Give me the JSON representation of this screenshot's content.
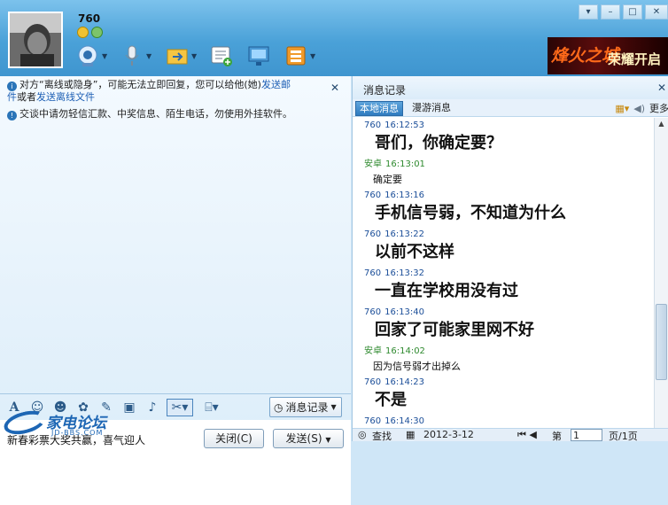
{
  "header": {
    "username": "760"
  },
  "toolbar": {
    "items": [
      "webcam",
      "microphone",
      "file-transfer",
      "sms",
      "remote-assistance",
      "apps"
    ]
  },
  "ad": {
    "text1": "烽火之城",
    "text2": "荣耀开启"
  },
  "left": {
    "notice1_a": "对方“离线或隐身”，可能无法立即回复，您可以给他(她)",
    "notice1_link1": "发送邮",
    "notice1_b": "件",
    "notice1_c": "或者",
    "notice1_link2": "发送离线文件",
    "notice2": "交谈中请勿轻信汇款、中奖信息、陌生电话，勿使用外挂软件。",
    "msg_record_btn": "消息记录",
    "bottom_text": "新春彩票大奖共赢，喜气迎人",
    "close_btn": "关闭(C)",
    "send_btn": "发送(S)",
    "logo_title": "家电论坛",
    "logo_sub": "JD-BBS.COM"
  },
  "right": {
    "title": "消息记录",
    "tab_local": "本地消息",
    "tab_roam": "漫游消息",
    "more": "更多",
    "messages": [
      {
        "sender": "760",
        "time": "16:12:53",
        "text": "哥们，你确定要？",
        "big": true
      },
      {
        "sender": "安卓",
        "time": "16:13:01",
        "text": "确定要",
        "big": false
      },
      {
        "sender": "760",
        "time": "16:13:16",
        "text": "手机信号弱，不知道为什么",
        "big": true
      },
      {
        "sender": "760",
        "time": "16:13:22",
        "text": "以前不这样",
        "big": true
      },
      {
        "sender": "760",
        "time": "16:13:32",
        "text": "一直在学校用没有过",
        "big": true
      },
      {
        "sender": "760",
        "time": "16:13:40",
        "text": "回家了可能家里网不好",
        "big": true
      },
      {
        "sender": "安卓",
        "time": "16:14:02",
        "text": "因为信号弱才出掉么",
        "big": false
      },
      {
        "sender": "760",
        "time": "16:14:23",
        "text": "不是",
        "big": true
      },
      {
        "sender": "760",
        "time": "16:14:30",
        "text": "",
        "big": false
      }
    ],
    "footer_find": "查找",
    "footer_date": "2012-3-12",
    "footer_page_label": "第",
    "footer_page": "1",
    "footer_total": "页/1页"
  }
}
